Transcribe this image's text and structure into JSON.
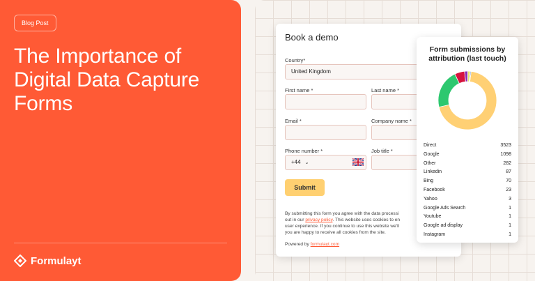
{
  "hero": {
    "badge": "Blog Post",
    "title": "The Importance of Digital Data Capture Forms",
    "brand": "Formulayt",
    "background": "#ff5a35"
  },
  "form": {
    "title": "Book a demo",
    "country_label": "Country*",
    "country_value": "United Kingdom",
    "first_name_label": "First name *",
    "last_name_label": "Last name *",
    "email_label": "Email *",
    "company_label": "Company name *",
    "phone_label": "Phone number *",
    "phone_code": "+44",
    "flag_icon": "uk-flag-icon",
    "job_title_label": "Job title *",
    "submit_label": "Submit",
    "consent_prefix": "By submitting this form you agree with the data processi",
    "consent_line2_prefix": "out in our ",
    "privacy_link": "privacy policy",
    "consent_line2_suffix": ". This website uses cookies to en",
    "consent_line3": "user experience. If you continue to use this website we'll",
    "consent_line4": "you are happy to receive all cookies from the site.",
    "powered_prefix": "Powered by ",
    "powered_link": "formulayt.com",
    "accent": "#ff5a35",
    "button_color": "#ffd071"
  },
  "attribution": {
    "title_line1": "Form submissions by",
    "title_line2": "attribution (last touch)",
    "rows": [
      {
        "source": "Direct",
        "count": "3523"
      },
      {
        "source": "Google",
        "count": "1098"
      },
      {
        "source": "Other",
        "count": "282"
      },
      {
        "source": "Linkedin",
        "count": "87"
      },
      {
        "source": "Bing",
        "count": "70"
      },
      {
        "source": "Facebook",
        "count": "23"
      },
      {
        "source": "Yahoo",
        "count": "3"
      },
      {
        "source": "Google Ads Search",
        "count": "1"
      },
      {
        "source": "Youtube",
        "count": "1"
      },
      {
        "source": "Google ad display",
        "count": "1"
      },
      {
        "source": "Instagram",
        "count": "1"
      }
    ]
  },
  "chart_data": {
    "type": "pie",
    "categories": [
      "Direct",
      "Google",
      "Other",
      "Linkedin",
      "Bing",
      "Facebook"
    ],
    "values": [
      3523,
      1098,
      282,
      87,
      70,
      23
    ],
    "colors": [
      "#ffd074",
      "#2dc86f",
      "#d6143f",
      "#8a2bb5",
      "#e8e86a",
      "#2a66d6"
    ]
  }
}
